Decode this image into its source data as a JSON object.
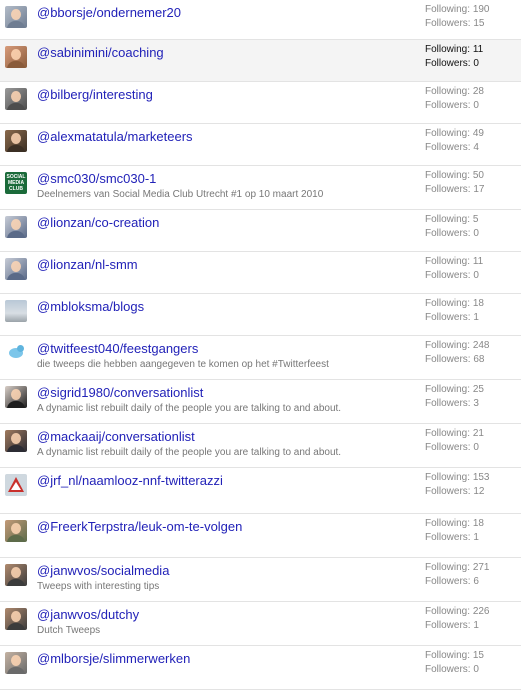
{
  "lists": [
    {
      "name": "@bborsje/ondernemer20",
      "description": "",
      "following_label": "Following:",
      "following": "190",
      "followers_label": "Followers:",
      "followers": "15",
      "avatar": "person-avatar",
      "colors": [
        "#6f7d92",
        "#b3bcc8"
      ],
      "highlighted": false
    },
    {
      "name": "@sabinimini/coaching",
      "description": "",
      "following_label": "Following:",
      "following": "11",
      "followers_label": "Followers:",
      "followers": "0",
      "avatar": "person-avatar",
      "colors": [
        "#8a5b3a",
        "#d89b7a"
      ],
      "highlighted": true
    },
    {
      "name": "@bilberg/interesting",
      "description": "",
      "following_label": "Following:",
      "following": "28",
      "followers_label": "Followers:",
      "followers": "0",
      "avatar": "person-avatar",
      "colors": [
        "#4d4d4d",
        "#9a9a9a"
      ],
      "highlighted": false
    },
    {
      "name": "@alexmatatula/marketeers",
      "description": "",
      "following_label": "Following:",
      "following": "49",
      "followers_label": "Followers:",
      "followers": "4",
      "avatar": "person-avatar",
      "colors": [
        "#3b2f24",
        "#8b6a4c"
      ],
      "highlighted": false
    },
    {
      "name": "@smc030/smc030-1",
      "description": "Deelnemers van Social Media Club Utrecht #1 op 10 maart 2010",
      "following_label": "Following:",
      "following": "50",
      "followers_label": "Followers:",
      "followers": "17",
      "avatar": "social-media-club-logo",
      "logo_text": "SOCIAL MEDIA CLUB",
      "colors": [
        "#1b6b3a",
        "#2e8b4f"
      ],
      "highlighted": false
    },
    {
      "name": "@lionzan/co-creation",
      "description": "",
      "following_label": "Following:",
      "following": "5",
      "followers_label": "Followers:",
      "followers": "0",
      "avatar": "person-avatar",
      "colors": [
        "#5a6a88",
        "#c7ccd6"
      ],
      "highlighted": false
    },
    {
      "name": "@lionzan/nl-smm",
      "description": "",
      "following_label": "Following:",
      "following": "11",
      "followers_label": "Followers:",
      "followers": "0",
      "avatar": "person-avatar",
      "colors": [
        "#5a6a88",
        "#c7ccd6"
      ],
      "highlighted": false
    },
    {
      "name": "@mbloksma/blogs",
      "description": "",
      "following_label": "Following:",
      "following": "18",
      "followers_label": "Followers:",
      "followers": "1",
      "avatar": "landscape-avatar",
      "colors": [
        "#b9c8d6",
        "#9aa3a9"
      ],
      "highlighted": false
    },
    {
      "name": "@twitfeest040/feestgangers",
      "description": "die tweeps die hebben aangegeven te komen op het #Twitterfeest",
      "following_label": "Following:",
      "following": "248",
      "followers_label": "Followers:",
      "followers": "68",
      "avatar": "bird-avatar",
      "colors": [
        "#ffffff",
        "#7cc6ea"
      ],
      "highlighted": false
    },
    {
      "name": "@sigrid1980/conversationlist",
      "description": "A dynamic list rebuilt daily of the people you are talking to and about.",
      "following_label": "Following:",
      "following": "25",
      "followers_label": "Followers:",
      "followers": "3",
      "avatar": "person-avatar",
      "colors": [
        "#1e1e1e",
        "#d9cfc8"
      ],
      "highlighted": false
    },
    {
      "name": "@mackaaij/conversationlist",
      "description": "A dynamic list rebuilt daily of the people you are talking to and about.",
      "following_label": "Following:",
      "following": "21",
      "followers_label": "Followers:",
      "followers": "0",
      "avatar": "person-avatar",
      "colors": [
        "#2c2c34",
        "#a07a5e"
      ],
      "highlighted": false
    },
    {
      "name": "@jrf_nl/naamlooz-nnf-twitterazzi",
      "description": "",
      "following_label": "Following:",
      "following": "153",
      "followers_label": "Followers:",
      "followers": "12",
      "avatar": "warning-sign-avatar",
      "colors": [
        "#cfd8df",
        "#c9302c"
      ],
      "highlighted": false
    },
    {
      "name": "@FreerkTerpstra/leuk-om-te-volgen",
      "description": "",
      "following_label": "Following:",
      "following": "18",
      "followers_label": "Followers:",
      "followers": "1",
      "avatar": "person-avatar",
      "colors": [
        "#5d6b4a",
        "#c49a78"
      ],
      "highlighted": false
    },
    {
      "name": "@janwvos/socialmedia",
      "description": "Tweeps with interesting tips",
      "following_label": "Following:",
      "following": "271",
      "followers_label": "Followers:",
      "followers": "6",
      "avatar": "person-avatar",
      "colors": [
        "#3c3c3c",
        "#b08a6e"
      ],
      "highlighted": false
    },
    {
      "name": "@janwvos/dutchy",
      "description": "Dutch Tweeps",
      "following_label": "Following:",
      "following": "226",
      "followers_label": "Followers:",
      "followers": "1",
      "avatar": "person-avatar",
      "colors": [
        "#3c3c3c",
        "#b08a6e"
      ],
      "highlighted": false
    },
    {
      "name": "@mlborsje/slimmerwerken",
      "description": "",
      "following_label": "Following:",
      "following": "15",
      "followers_label": "Followers:",
      "followers": "0",
      "avatar": "person-avatar",
      "colors": [
        "#6a6a6a",
        "#c4b2a2"
      ],
      "highlighted": false
    }
  ]
}
